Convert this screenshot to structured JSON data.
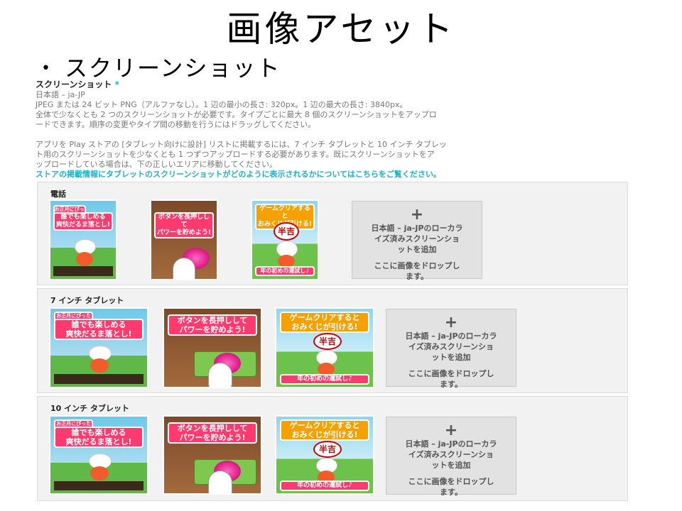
{
  "slide": {
    "title": "画像アセット",
    "bullet": "スクリーンショット"
  },
  "section": {
    "title": "スクリーンショット",
    "required_mark": "*",
    "lang": "日本語 – ja-JP",
    "format": "JPEG または 24 ビット PNG（アルファなし）。1 辺の最小の長さ: 320px。1 辺の最大の長さ: 3840px。",
    "requirement_a": "全体で少なくとも 2 つのスクリーンショットが必要です。タイプごとに最大 8 個のスクリーンショットをアップロ",
    "requirement_b": "ードできます。順序の変更やタイプ間の移動を行うにはドラッグしてください。",
    "tablet_a": "アプリを Play ストアの [タブレット向けに設計] リストに掲載するには、7 インチ タブレットと 10 インチ タブレッ",
    "tablet_b": "ト用のスクリーンショットを少なくとも 1 つずつアップロードする必要があります。既にスクリーンショットをア",
    "tablet_c": "ップロードしている場合は、下の正しいエリアに移動してください。",
    "link": "ストアの掲載情報にタブレットのスクリーンショットがどのように表示されるかについてはこちらをご覧ください。"
  },
  "groups": [
    {
      "title": "電話"
    },
    {
      "title": "7 インチ タブレット"
    },
    {
      "title": "10 インチ タブレット"
    }
  ],
  "thumb_text": {
    "banner1_small": "お正月にぴったり",
    "banner1_line1": "誰でも楽しめる",
    "banner1_line2": "爽快だるま落とし!",
    "banner2_line1": "ボタンを長押しして",
    "banner2_line2": "パワーを貯めよう!",
    "banner3_line1": "ゲームクリアすると",
    "banner3_line2": "おみくじが引ける!",
    "fortune": "半吉",
    "footer3": "年の初めの運試し♪"
  },
  "add_box": {
    "plus": "+",
    "line1": "日本語 – ja-JPのローカラ",
    "line2": "イズ済みスクリーンショ",
    "line3": "ットを追加",
    "drop1": "ここに画像をドロップし",
    "drop2": "ます。"
  },
  "colors": {
    "accent": "#1ab3cc",
    "banner_pink": "#ff3a6e",
    "banner_orange": "#f6a100"
  }
}
